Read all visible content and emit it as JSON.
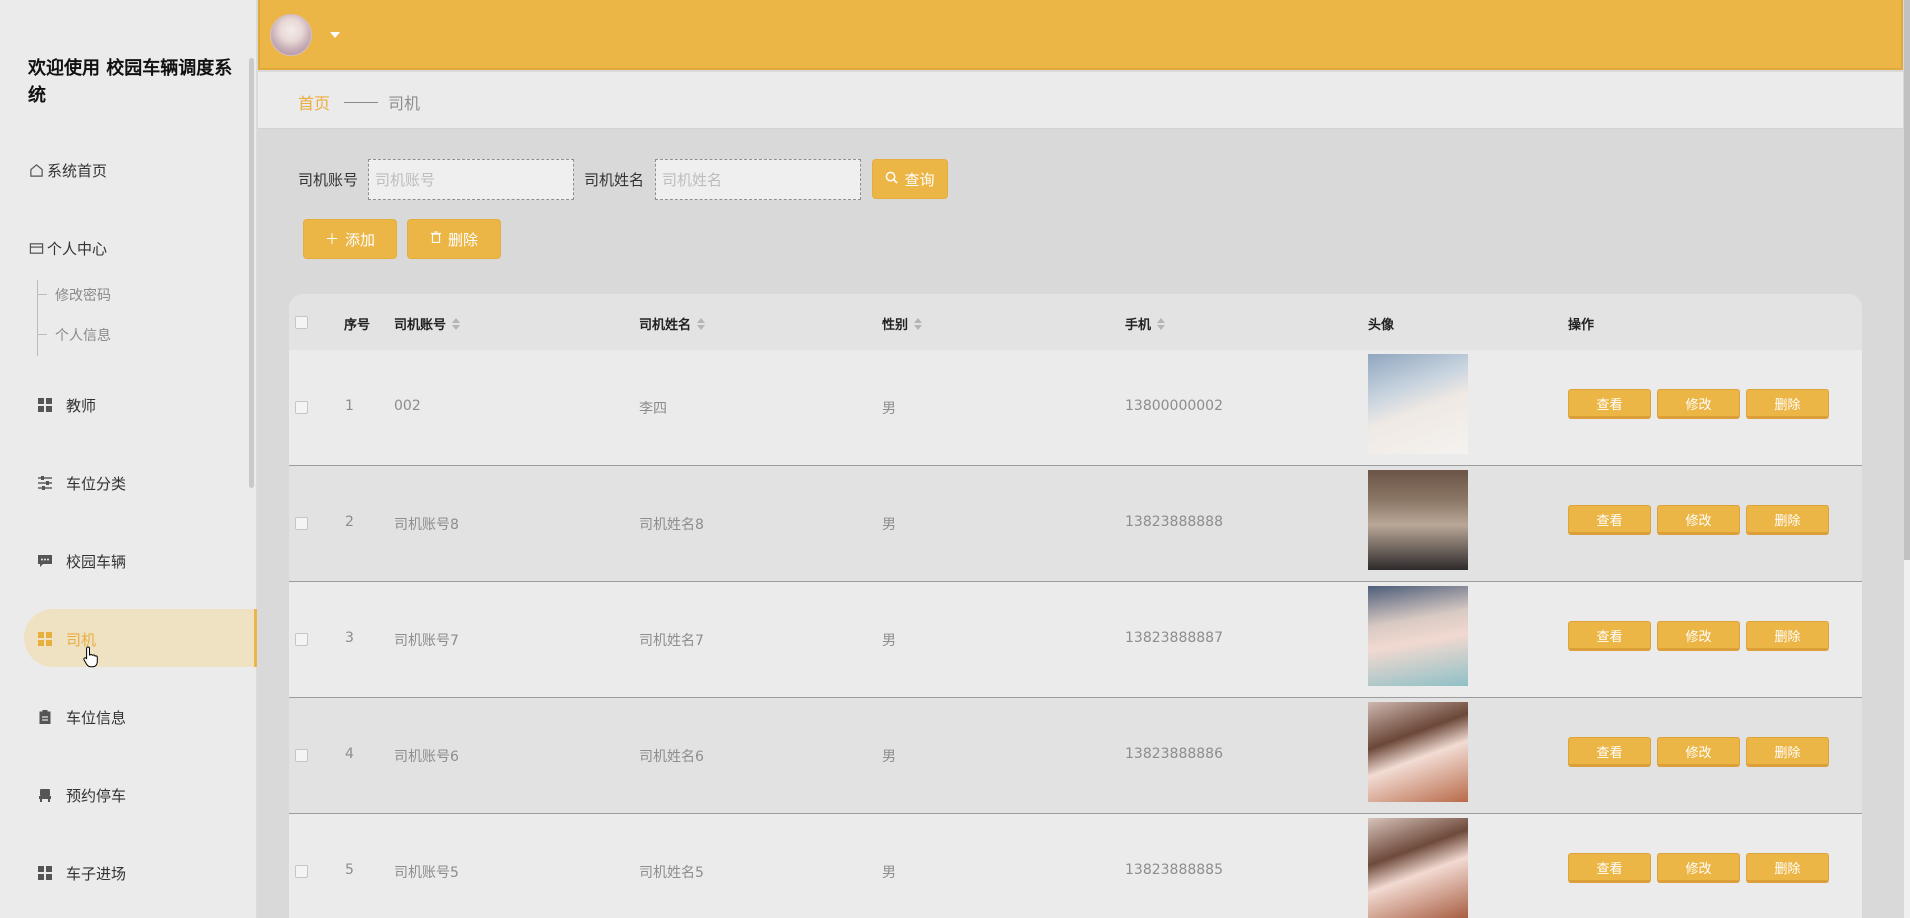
{
  "sidebar": {
    "title": "欢迎使用 校园车辆调度系统",
    "items": [
      {
        "label": "系统首页",
        "icon": "home-icon"
      },
      {
        "label": "个人中心",
        "icon": "card-icon"
      },
      {
        "label": "教师",
        "icon": "grid-icon"
      },
      {
        "label": "车位分类",
        "icon": "sliders-icon"
      },
      {
        "label": "校园车辆",
        "icon": "message-icon"
      },
      {
        "label": "司机",
        "icon": "grid-icon",
        "active": true
      },
      {
        "label": "车位信息",
        "icon": "clipboard-icon"
      },
      {
        "label": "预约停车",
        "icon": "seat-icon"
      },
      {
        "label": "车子进场",
        "icon": "grid-icon"
      }
    ],
    "submenu": [
      "修改密码",
      "个人信息"
    ]
  },
  "breadcrumb": {
    "home": "首页",
    "current": "司机"
  },
  "search": {
    "account_label": "司机账号",
    "account_placeholder": "司机账号",
    "name_label": "司机姓名",
    "name_placeholder": "司机姓名",
    "query_label": "查询"
  },
  "toolbar": {
    "add_label": "添加",
    "delete_label": "删除"
  },
  "table": {
    "headers": {
      "index": "序号",
      "account": "司机账号",
      "name": "司机姓名",
      "gender": "性别",
      "phone": "手机",
      "avatar": "头像",
      "actions": "操作"
    },
    "rows": [
      {
        "index": "1",
        "account": "002",
        "name": "李四",
        "gender": "男",
        "phone": "13800000002"
      },
      {
        "index": "2",
        "account": "司机账号8",
        "name": "司机姓名8",
        "gender": "男",
        "phone": "13823888888"
      },
      {
        "index": "3",
        "account": "司机账号7",
        "name": "司机姓名7",
        "gender": "男",
        "phone": "13823888887"
      },
      {
        "index": "4",
        "account": "司机账号6",
        "name": "司机姓名6",
        "gender": "男",
        "phone": "13823888886"
      },
      {
        "index": "5",
        "account": "司机账号5",
        "name": "司机姓名5",
        "gender": "男",
        "phone": "13823888885"
      }
    ],
    "action_labels": {
      "view": "查看",
      "edit": "修改",
      "delete": "删除"
    }
  },
  "colors": {
    "accent": "#ecb647",
    "active_bg": "#efe2c2",
    "active_text": "#e9ae3d"
  }
}
